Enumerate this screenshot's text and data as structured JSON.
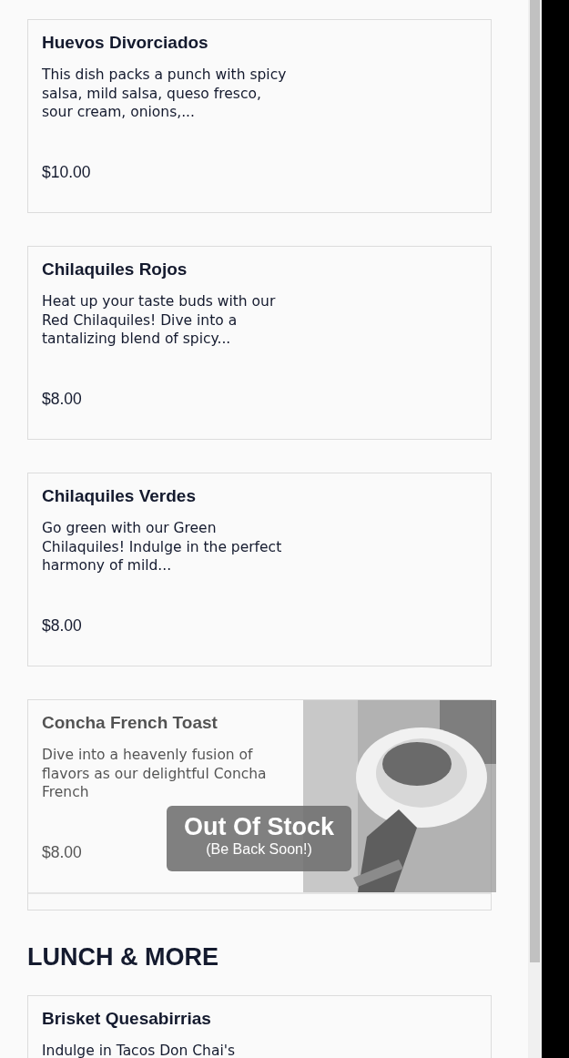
{
  "items": [
    {
      "name": "Huevos Divorciados",
      "description": "This dish packs a punch with spicy salsa, mild salsa, queso fresco, sour cream, onions,...",
      "price": "$10.00",
      "out_of_stock": false
    },
    {
      "name": "Chilaquiles Rojos",
      "description": "Heat up your taste buds with our Red Chilaquiles! Dive into a tantalizing blend of spicy...",
      "price": "$8.00",
      "out_of_stock": false
    },
    {
      "name": "Chilaquiles Verdes",
      "description": "Go green with our Green Chilaquiles! Indulge in the perfect harmony of mild...",
      "price": "$8.00",
      "out_of_stock": false
    },
    {
      "name": "Concha French Toast",
      "description": "Dive into a heavenly fusion of flavors as our delightful Concha French",
      "price": "$8.00",
      "out_of_stock": true,
      "stock_label": "Out Of Stock",
      "stock_note": "(Be Back Soon!)"
    }
  ],
  "sections": [
    {
      "heading": "LUNCH & MORE",
      "items": [
        {
          "name": "Brisket Quesabirrias",
          "description": "Indulge in Tacos Don Chai's",
          "out_of_stock": false
        }
      ]
    }
  ]
}
